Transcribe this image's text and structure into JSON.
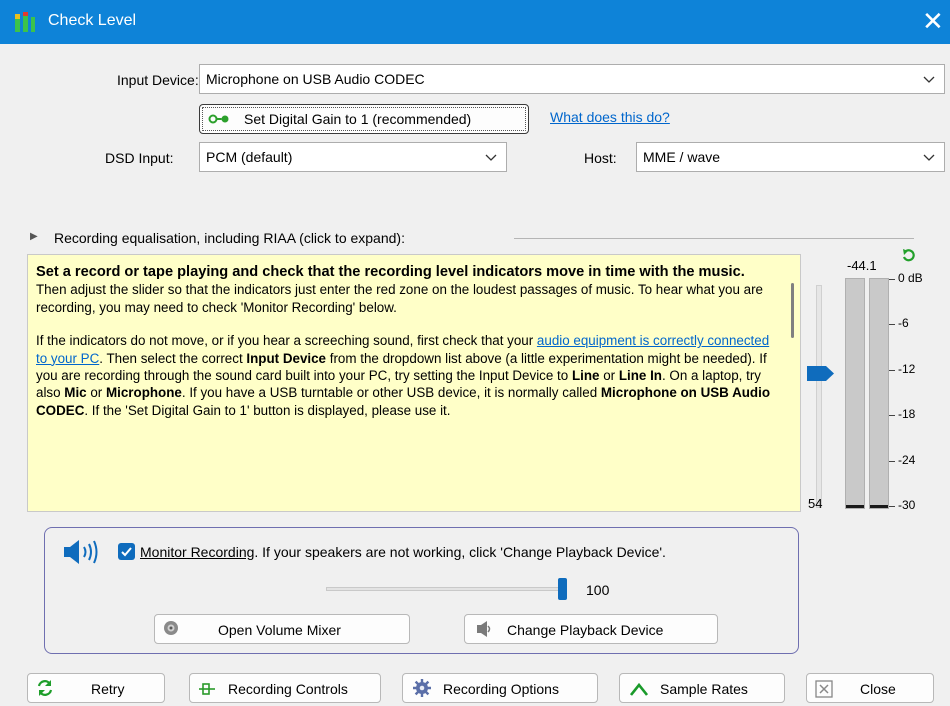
{
  "window": {
    "title": "Check Level",
    "close_glyph": "✕"
  },
  "input_device": {
    "label": "Input Device:",
    "value": "Microphone on USB Audio CODEC"
  },
  "digital_gain": {
    "button_label": "Set Digital Gain to 1 (recommended)",
    "help_link": "What does this do?"
  },
  "dsd_input": {
    "label": "DSD Input:",
    "value": "PCM (default)"
  },
  "host": {
    "label": "Host:",
    "value": "MME / wave"
  },
  "equalisation": {
    "arrow": "▶",
    "label": "Recording equalisation, including RIAA (click to expand):"
  },
  "help": {
    "p1_bold": "Set a record or tape playing and check that the recording level indicators move in time with the music.",
    "p1_rest": " Then adjust the slider so that the indicators just enter the red zone on the loudest passages of music.  To hear what you are recording, you may need to check 'Monitor Recording' below.",
    "p2_a": "If the indicators do not move, or if you hear a screeching sound, first check that your ",
    "p2_link": "audio equipment is correctly connected to your PC",
    "p2_b": ".  Then select the correct ",
    "p2_input_device": "Input Device",
    "p2_c": " from the dropdown list above (a little experimentation might be needed).  If you are recording through the sound card built into your PC, try setting the Input Device to ",
    "p2_line": "Line",
    "p2_or1": " or ",
    "p2_line_in": "Line In",
    "p2_d": ".  On a laptop, try also ",
    "p2_mic": "Mic",
    "p2_or2": " or ",
    "p2_microphone": "Microphone",
    "p2_e": ".  If you have a USB turntable or other USB device, it is normally called ",
    "p2_usb": "Microphone on USB Audio CODEC",
    "p2_f": ".  If the 'Set Digital Gain to 1' button is displayed, please use it."
  },
  "meter": {
    "peak_readout": "-44.1",
    "level_readout": "54",
    "ticks": [
      "0 dB",
      "-6",
      "-12",
      "-18",
      "-24",
      "-30"
    ],
    "level_fraction": 0.0
  },
  "monitor": {
    "checkbox_checked": true,
    "label": "Monitor Recording",
    "hint": ".  If your speakers are not working, click 'Change Playback Device'.",
    "volume_value": "100",
    "volume_fraction": 1.0,
    "open_mixer_label": "Open Volume Mixer",
    "change_playback_label": "Change Playback Device"
  },
  "buttons": {
    "retry": "Retry",
    "recording_controls": "Recording Controls",
    "recording_options": "Recording Options",
    "sample_rates": "Sample Rates",
    "close": "Close"
  },
  "colors": {
    "title_bar": "#0e83d8",
    "accent": "#0f6cbd",
    "help_bg": "#ffffc8",
    "link": "#0066cc"
  }
}
